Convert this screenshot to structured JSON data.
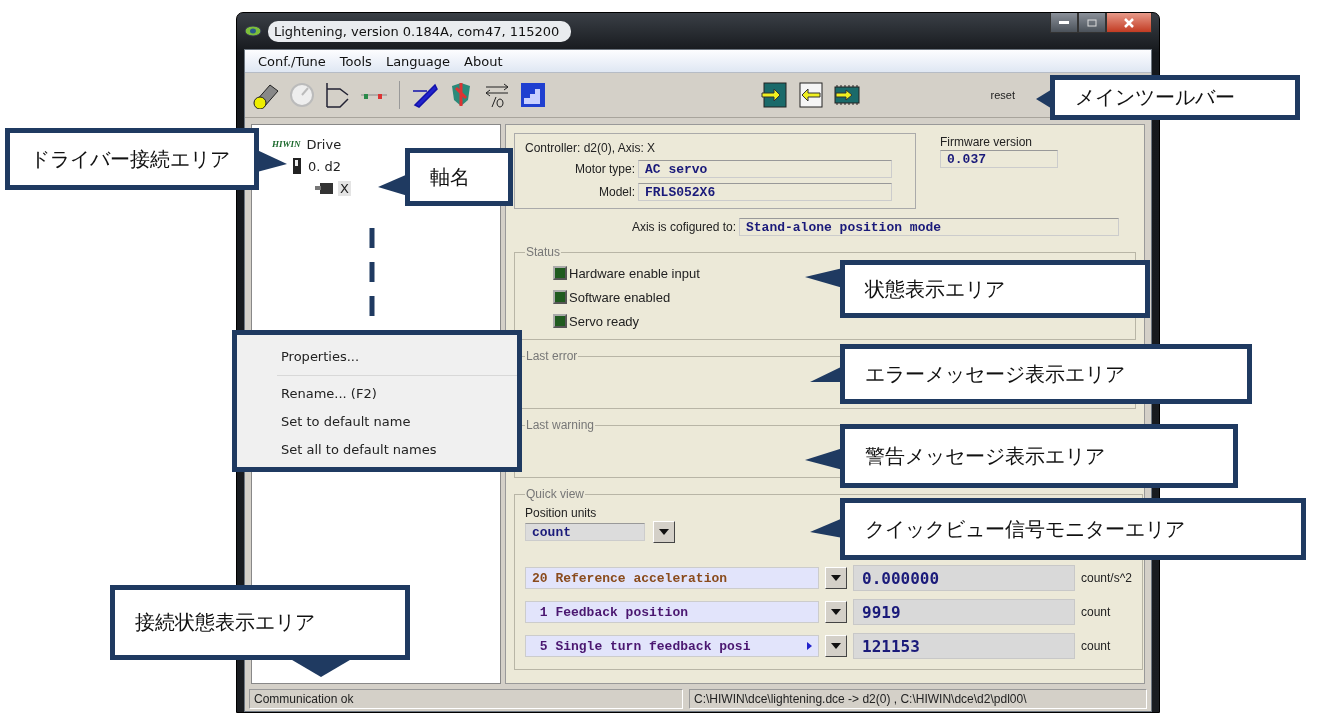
{
  "window": {
    "title": "Lightening, version 0.184A, com47, 115200"
  },
  "menu": [
    {
      "label": "Conf./Tune"
    },
    {
      "label": "Tools"
    },
    {
      "label": "Language"
    },
    {
      "label": "About"
    }
  ],
  "toolbar": {
    "reset_label": "reset"
  },
  "tree": {
    "logo": "HIWIN",
    "root": "Drive",
    "children": [
      {
        "label": "0. d2",
        "children": [
          {
            "label": "X",
            "selected": true
          }
        ]
      }
    ]
  },
  "context_menu": {
    "groups": [
      [
        "Properties..."
      ],
      [
        "Rename... (F2)",
        "Set to default name",
        "Set all to default names"
      ]
    ]
  },
  "info": {
    "controller_line": "Controller: d2(0),  Axis: X",
    "motor_type_label": "Motor type:",
    "motor_type": "AC servo",
    "model_label": "Model:",
    "model": "FRLS052X6",
    "firmware_label": "Firmware version",
    "firmware": "0.037",
    "axis_config_label": "Axis is cofigured to:",
    "axis_config": "Stand-alone position mode"
  },
  "status": {
    "title": "Status",
    "items": [
      {
        "label": "Hardware enable input",
        "on": true
      },
      {
        "label": "Software enabled",
        "on": true
      },
      {
        "label": "Servo ready",
        "on": true
      }
    ]
  },
  "last_error": {
    "title": "Last error"
  },
  "last_warning": {
    "title": "Last warning"
  },
  "quick_view": {
    "title": "Quick view",
    "units_label": "Position units",
    "units": "count",
    "rows": [
      {
        "signal": "20 Reference acceleration",
        "color": "#8a4b1c",
        "overflow": false,
        "value": "0.000000",
        "unit": "count/s^2"
      },
      {
        "signal": " 1 Feedback position",
        "color": "#4a1670",
        "overflow": false,
        "value": "9919",
        "unit": "count"
      },
      {
        "signal": " 5 Single turn feedback posi",
        "color": "#4a1670",
        "overflow": true,
        "value": "121153",
        "unit": "count"
      }
    ]
  },
  "status_bar": {
    "connection": "Communication ok",
    "path": "C:\\HIWIN\\dce\\lightening.dce -> d2(0) , C:\\HIWIN\\dce\\d2\\pdl00\\"
  },
  "callouts": [
    {
      "text": "メインツールバー"
    },
    {
      "text": "ドライバー接続エリア"
    },
    {
      "text": "軸名"
    },
    {
      "text": "状態表示エリア"
    },
    {
      "text": "エラーメッセージ表示エリア"
    },
    {
      "text": "警告メッセージ表示エリア"
    },
    {
      "text": "クイックビュー信号モニターエリア"
    },
    {
      "text": "接続状態表示エリア"
    }
  ]
}
